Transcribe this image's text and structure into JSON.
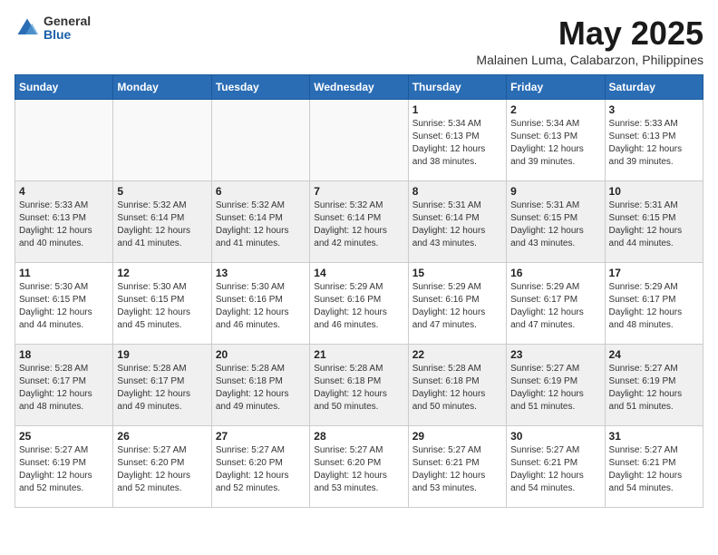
{
  "logo": {
    "general": "General",
    "blue": "Blue"
  },
  "title": "May 2025",
  "subtitle": "Malainen Luma, Calabarzon, Philippines",
  "days_of_week": [
    "Sunday",
    "Monday",
    "Tuesday",
    "Wednesday",
    "Thursday",
    "Friday",
    "Saturday"
  ],
  "weeks": [
    [
      {
        "num": "",
        "info": ""
      },
      {
        "num": "",
        "info": ""
      },
      {
        "num": "",
        "info": ""
      },
      {
        "num": "",
        "info": ""
      },
      {
        "num": "1",
        "info": "Sunrise: 5:34 AM\nSunset: 6:13 PM\nDaylight: 12 hours\nand 38 minutes."
      },
      {
        "num": "2",
        "info": "Sunrise: 5:34 AM\nSunset: 6:13 PM\nDaylight: 12 hours\nand 39 minutes."
      },
      {
        "num": "3",
        "info": "Sunrise: 5:33 AM\nSunset: 6:13 PM\nDaylight: 12 hours\nand 39 minutes."
      }
    ],
    [
      {
        "num": "4",
        "info": "Sunrise: 5:33 AM\nSunset: 6:13 PM\nDaylight: 12 hours\nand 40 minutes."
      },
      {
        "num": "5",
        "info": "Sunrise: 5:32 AM\nSunset: 6:14 PM\nDaylight: 12 hours\nand 41 minutes."
      },
      {
        "num": "6",
        "info": "Sunrise: 5:32 AM\nSunset: 6:14 PM\nDaylight: 12 hours\nand 41 minutes."
      },
      {
        "num": "7",
        "info": "Sunrise: 5:32 AM\nSunset: 6:14 PM\nDaylight: 12 hours\nand 42 minutes."
      },
      {
        "num": "8",
        "info": "Sunrise: 5:31 AM\nSunset: 6:14 PM\nDaylight: 12 hours\nand 43 minutes."
      },
      {
        "num": "9",
        "info": "Sunrise: 5:31 AM\nSunset: 6:15 PM\nDaylight: 12 hours\nand 43 minutes."
      },
      {
        "num": "10",
        "info": "Sunrise: 5:31 AM\nSunset: 6:15 PM\nDaylight: 12 hours\nand 44 minutes."
      }
    ],
    [
      {
        "num": "11",
        "info": "Sunrise: 5:30 AM\nSunset: 6:15 PM\nDaylight: 12 hours\nand 44 minutes."
      },
      {
        "num": "12",
        "info": "Sunrise: 5:30 AM\nSunset: 6:15 PM\nDaylight: 12 hours\nand 45 minutes."
      },
      {
        "num": "13",
        "info": "Sunrise: 5:30 AM\nSunset: 6:16 PM\nDaylight: 12 hours\nand 46 minutes."
      },
      {
        "num": "14",
        "info": "Sunrise: 5:29 AM\nSunset: 6:16 PM\nDaylight: 12 hours\nand 46 minutes."
      },
      {
        "num": "15",
        "info": "Sunrise: 5:29 AM\nSunset: 6:16 PM\nDaylight: 12 hours\nand 47 minutes."
      },
      {
        "num": "16",
        "info": "Sunrise: 5:29 AM\nSunset: 6:17 PM\nDaylight: 12 hours\nand 47 minutes."
      },
      {
        "num": "17",
        "info": "Sunrise: 5:29 AM\nSunset: 6:17 PM\nDaylight: 12 hours\nand 48 minutes."
      }
    ],
    [
      {
        "num": "18",
        "info": "Sunrise: 5:28 AM\nSunset: 6:17 PM\nDaylight: 12 hours\nand 48 minutes."
      },
      {
        "num": "19",
        "info": "Sunrise: 5:28 AM\nSunset: 6:17 PM\nDaylight: 12 hours\nand 49 minutes."
      },
      {
        "num": "20",
        "info": "Sunrise: 5:28 AM\nSunset: 6:18 PM\nDaylight: 12 hours\nand 49 minutes."
      },
      {
        "num": "21",
        "info": "Sunrise: 5:28 AM\nSunset: 6:18 PM\nDaylight: 12 hours\nand 50 minutes."
      },
      {
        "num": "22",
        "info": "Sunrise: 5:28 AM\nSunset: 6:18 PM\nDaylight: 12 hours\nand 50 minutes."
      },
      {
        "num": "23",
        "info": "Sunrise: 5:27 AM\nSunset: 6:19 PM\nDaylight: 12 hours\nand 51 minutes."
      },
      {
        "num": "24",
        "info": "Sunrise: 5:27 AM\nSunset: 6:19 PM\nDaylight: 12 hours\nand 51 minutes."
      }
    ],
    [
      {
        "num": "25",
        "info": "Sunrise: 5:27 AM\nSunset: 6:19 PM\nDaylight: 12 hours\nand 52 minutes."
      },
      {
        "num": "26",
        "info": "Sunrise: 5:27 AM\nSunset: 6:20 PM\nDaylight: 12 hours\nand 52 minutes."
      },
      {
        "num": "27",
        "info": "Sunrise: 5:27 AM\nSunset: 6:20 PM\nDaylight: 12 hours\nand 52 minutes."
      },
      {
        "num": "28",
        "info": "Sunrise: 5:27 AM\nSunset: 6:20 PM\nDaylight: 12 hours\nand 53 minutes."
      },
      {
        "num": "29",
        "info": "Sunrise: 5:27 AM\nSunset: 6:21 PM\nDaylight: 12 hours\nand 53 minutes."
      },
      {
        "num": "30",
        "info": "Sunrise: 5:27 AM\nSunset: 6:21 PM\nDaylight: 12 hours\nand 54 minutes."
      },
      {
        "num": "31",
        "info": "Sunrise: 5:27 AM\nSunset: 6:21 PM\nDaylight: 12 hours\nand 54 minutes."
      }
    ]
  ]
}
